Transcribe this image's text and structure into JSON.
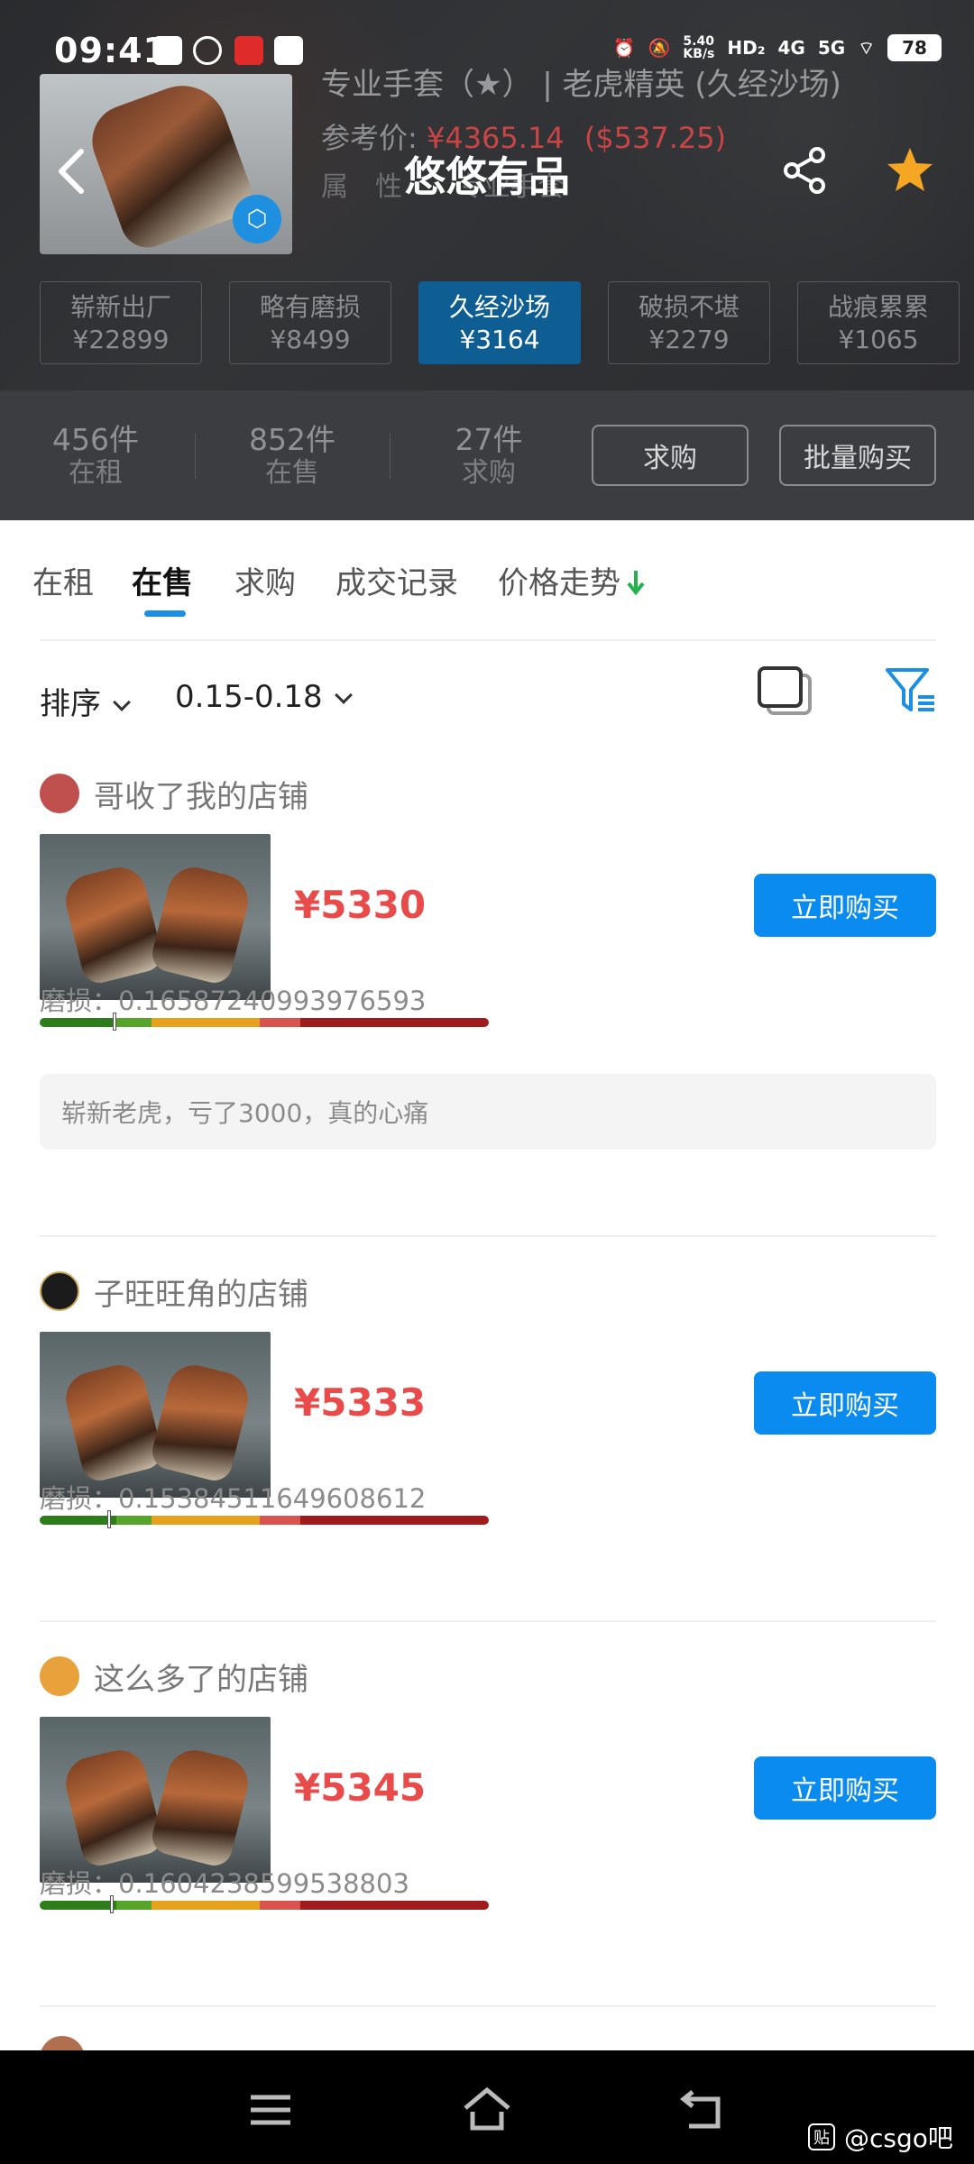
{
  "status_bar": {
    "time": "09:41",
    "net_speed": "5.40\nKB/s",
    "hd": "HD₂",
    "sig1": "4G",
    "sig2": "5G",
    "battery": "78"
  },
  "header": {
    "app_title": "悠悠有品",
    "item_title": "专业手套（★） | 老虎精英 (久经沙场)",
    "ref_label": "参考价:",
    "ref_price_cny": "¥4365.14",
    "ref_price_usd": "($537.25)",
    "attr_text": "属　性　　专业手套"
  },
  "wear_tabs": [
    {
      "name": "崭新出厂",
      "price": "¥22899",
      "active": false
    },
    {
      "name": "略有磨损",
      "price": "¥8499",
      "active": false
    },
    {
      "name": "久经沙场",
      "price": "¥3164",
      "active": true
    },
    {
      "name": "破损不堪",
      "price": "¥2279",
      "active": false
    },
    {
      "name": "战痕累累",
      "price": "¥1065",
      "active": false
    }
  ],
  "stats": {
    "rent": {
      "num": "456件",
      "label": "在租"
    },
    "sale": {
      "num": "852件",
      "label": "在售"
    },
    "buy": {
      "num": "27件",
      "label": "求购"
    },
    "buy_request_button": "求购",
    "bulk_buy_button": "批量购买"
  },
  "tabs": [
    "在租",
    "在售",
    "求购",
    "成交记录",
    "价格走势"
  ],
  "active_tab": "在售",
  "filters": {
    "sort_label": "排序",
    "range_label": "0.15-0.18"
  },
  "listings": [
    {
      "seller": "哥收了我的店铺",
      "price": "¥5330",
      "buy_label": "立即购买",
      "wear_label": "磨损：",
      "wear_value": "0.16587240993976593",
      "wear_fraction": 0.16587,
      "note": "崭新老虎，亏了3000，真的心痛",
      "avatar_color": "#c0504d"
    },
    {
      "seller": "子旺旺角的店铺",
      "price": "¥5333",
      "buy_label": "立即购买",
      "wear_label": "磨损：",
      "wear_value": "0.15384511649608612",
      "wear_fraction": 0.15385,
      "note": "",
      "avatar_color": "#1b1b1b"
    },
    {
      "seller": "这么多了的店铺",
      "price": "¥5345",
      "buy_label": "立即购买",
      "wear_label": "磨损：",
      "wear_value": "0.1604238599538803",
      "wear_fraction": 0.16042,
      "note": "",
      "avatar_color": "#e9a23b"
    }
  ],
  "watermark": {
    "text": "@csgo吧",
    "badge": "贴"
  },
  "colors": {
    "accent": "#0a8bf0",
    "price_red": "#e94b4b",
    "active_wear_tab": "#0f5e93",
    "star": "#f5a623"
  }
}
